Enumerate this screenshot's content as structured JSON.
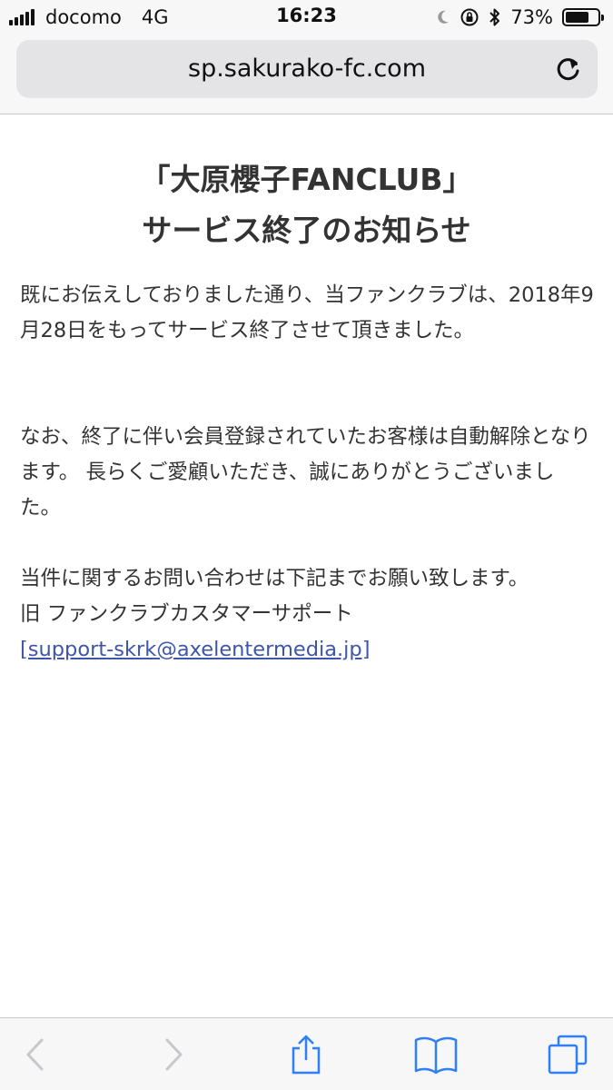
{
  "status_bar": {
    "carrier": "docomo",
    "network": "4G",
    "time": "16:23",
    "battery_percent": "73%",
    "battery_level": 0.73,
    "icons": [
      "moon-icon",
      "orientation-lock-icon",
      "bluetooth-icon"
    ]
  },
  "browser": {
    "url": "sp.sakurako-fc.com"
  },
  "page": {
    "title_line1": "「大原櫻子FANCLUB」",
    "title_line2": "サービス終了のお知らせ",
    "paragraph1": "既にお伝えしておりました通り、当ファンクラブは、2018年9月28日をもってサービス終了させて頂きました。",
    "paragraph2": "なお、終了に伴い会員登録されていたお客様は自動解除となります。 長らくご愛顧いただき、誠にありがとうございました。",
    "contact_line": "当件に関するお問い合わせは下記までお願い致します。",
    "support_name": "旧 ファンクラブカスタマーサポート",
    "support_email": "[support-skrk@axelentermedia.jp]"
  },
  "colors": {
    "link": "#3f56a8",
    "toolbar_icon_active": "#2f7ff6",
    "toolbar_icon_disabled": "#c7c7cc"
  }
}
